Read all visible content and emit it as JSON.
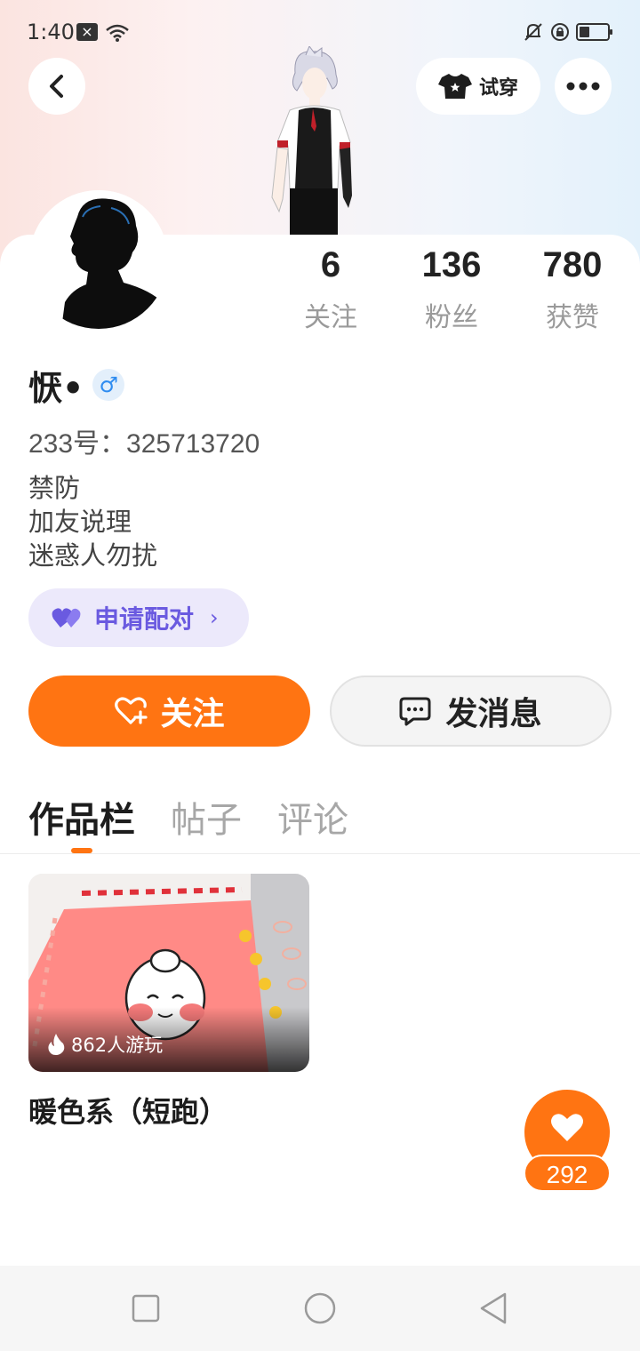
{
  "status_bar": {
    "time": "1:40"
  },
  "header": {
    "try_on_label": "试穿"
  },
  "stats": [
    {
      "value": "6",
      "label": "关注"
    },
    {
      "value": "136",
      "label": "粉丝"
    },
    {
      "value": "780",
      "label": "获赞"
    }
  ],
  "profile": {
    "username": "恹•",
    "gender_symbol": "♂",
    "account_id": "233号：325713720",
    "bio_lines": [
      "禁防",
      "加友说理",
      "迷惑人勿扰"
    ]
  },
  "actions": {
    "pair_label": "申请配对",
    "follow_label": "关注",
    "message_label": "发消息"
  },
  "tabs": [
    {
      "label": "作品栏",
      "active": true
    },
    {
      "label": "帖子",
      "active": false
    },
    {
      "label": "评论",
      "active": false
    }
  ],
  "works": [
    {
      "title": "暖色系（短跑）",
      "play_count": "862人游玩"
    }
  ],
  "like_count": "292",
  "colors": {
    "accent": "#ff7412",
    "pair": "#6a5ae0",
    "gender": "#2f8cf0"
  }
}
